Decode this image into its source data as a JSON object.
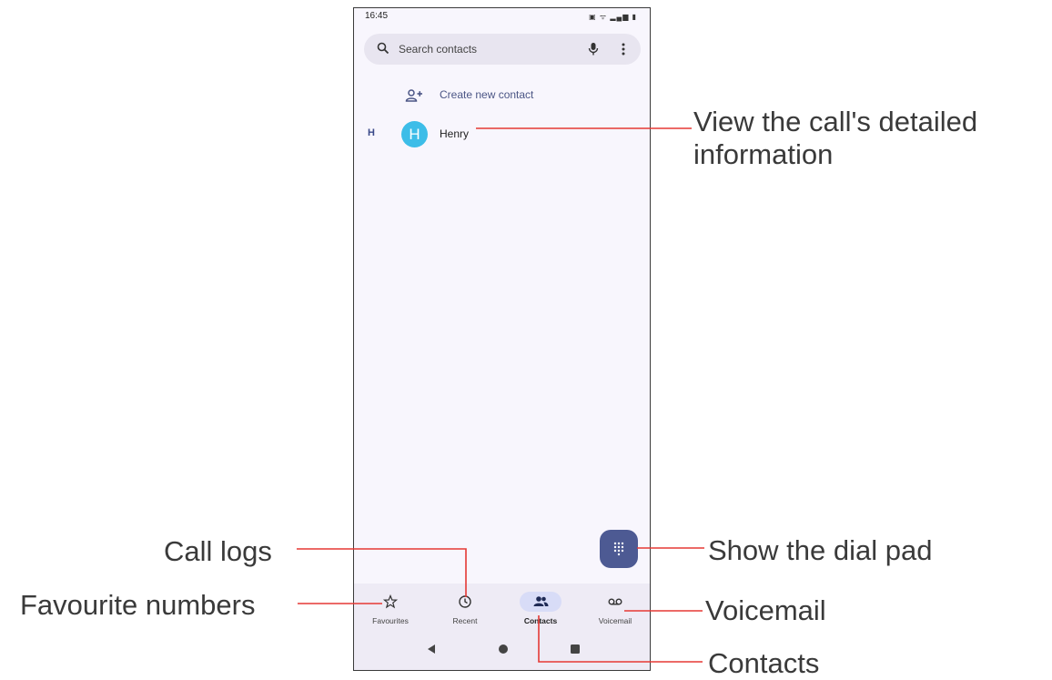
{
  "status_bar": {
    "time": "16:45",
    "icons": "▣ ᯤ ▂▄▆ ▮"
  },
  "search": {
    "placeholder": "Search contacts"
  },
  "create_contact": {
    "label": "Create new contact"
  },
  "contacts": [
    {
      "section": "H",
      "avatar_letter": "H",
      "name": "Henry",
      "avatar_color": "#3dbde8"
    }
  ],
  "bottom_nav": [
    {
      "label": "Favourites",
      "icon": "star-icon",
      "active": false
    },
    {
      "label": "Recent",
      "icon": "clock-icon",
      "active": false
    },
    {
      "label": "Contacts",
      "icon": "people-icon",
      "active": true
    },
    {
      "label": "Voicemail",
      "icon": "voicemail-icon",
      "active": false
    }
  ],
  "callouts": {
    "detail": "View the call's detailed\ninformation",
    "dialpad": "Show the dial pad",
    "voicemail": "Voicemail",
    "contacts": "Contacts",
    "call_logs": "Call logs",
    "favourites": "Favourite numbers"
  },
  "colors": {
    "accent": "#4d5a93",
    "callout_line": "#e53935",
    "avatar": "#3dbde8",
    "active_pill": "#d8dcf7"
  }
}
